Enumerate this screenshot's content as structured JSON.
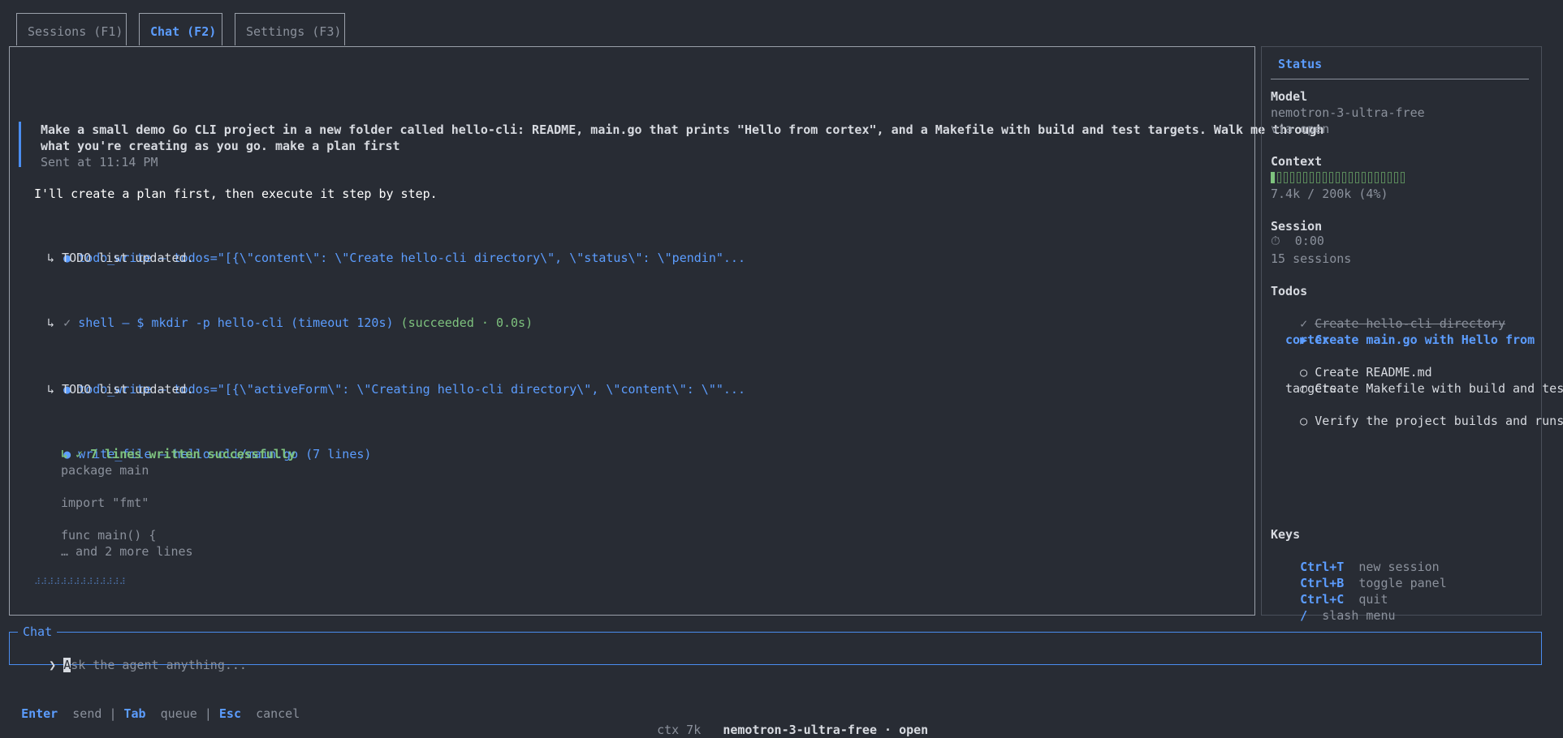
{
  "tabs": [
    {
      "label": "Sessions (F1)"
    },
    {
      "label": "Chat (F2)",
      "active": true
    },
    {
      "label": "Settings (F3)"
    }
  ],
  "chat": {
    "user_message_line1": "Make a small demo Go CLI project in a new folder called hello-cli: README, main.go that prints \"Hello from cortex\", and a Makefile with build and test targets. Walk me through",
    "user_message_line2": "what you're creating as you go. make a plan first",
    "sent_at": "Sent at 11:14 PM",
    "assistant_reply": "I'll create a plan first, then execute it step by step.",
    "tool1_call": "todo_write — todos=\"[{\\\"content\\\": \\\"Create hello-cli directory\\\", \\\"status\\\": \\\"pendin\"...",
    "tool1_result": "↳ TODO list updated.",
    "tool2_call": "shell — $ mkdir -p hello-cli (timeout 120s)",
    "tool2_status": "(succeeded · 0.0s)",
    "tool2_result": "↳",
    "tool3_call": "todo_write — todos=\"[{\\\"activeForm\\\": \\\"Creating hello-cli directory\\\", \\\"content\\\": \\\"\"...",
    "tool3_result": "↳ TODO list updated.",
    "tool4_call": "write_file — hello-cli/main.go (7 lines)",
    "tool4_result": "↳ ✓ 7 lines written successfully",
    "code_lines": [
      "package main",
      "",
      "import \"fmt\"",
      "",
      "func main() {",
      "… and 2 more lines"
    ],
    "spinner": "⠼⠼⠼⠼⠼⠼⠼⠼⠼⠼⠼⠼⠼⠼"
  },
  "status": {
    "title": "Status",
    "model_label": "Model",
    "model_name": "nemotron-3-ultra-free",
    "model_via": "via open",
    "context_label": "Context",
    "context_usage": "7.4k / 200k (4%)",
    "context_fraction": 0.04,
    "session_label": "Session",
    "session_time": "⏱  0:00",
    "session_count": "15 sessions",
    "todos_label": "Todos",
    "todos": [
      {
        "text": "Create hello-cli directory",
        "state": "done"
      },
      {
        "text": "Create main.go with Hello from",
        "text2": "cortex",
        "state": "active"
      },
      {
        "text": "Create README.md",
        "state": "pending"
      },
      {
        "text": "Create Makefile with build and test",
        "text2": "targets",
        "state": "pending"
      },
      {
        "text": "Verify the project builds and runs",
        "state": "pending"
      }
    ],
    "keys_label": "Keys",
    "keys": [
      {
        "key": "Ctrl+T",
        "desc": "new session"
      },
      {
        "key": "Ctrl+B",
        "desc": "toggle panel"
      },
      {
        "key": "Ctrl+C",
        "desc": "quit"
      },
      {
        "key": "/",
        "desc": "slash menu"
      }
    ]
  },
  "input": {
    "legend": "Chat",
    "prompt": "❯",
    "placeholder_first": "A",
    "placeholder_rest": "sk the agent anything..."
  },
  "footer": {
    "enter_key": "Enter",
    "enter_desc": "send",
    "tab_key": "Tab",
    "tab_desc": "queue",
    "esc_key": "Esc",
    "esc_desc": "cancel",
    "ctx": "ctx 7k",
    "model_info": "nemotron-3-ultra-free · open"
  },
  "colors": {
    "accent": "#5c9dff",
    "success": "#7ec27e",
    "background": "#282c34"
  }
}
